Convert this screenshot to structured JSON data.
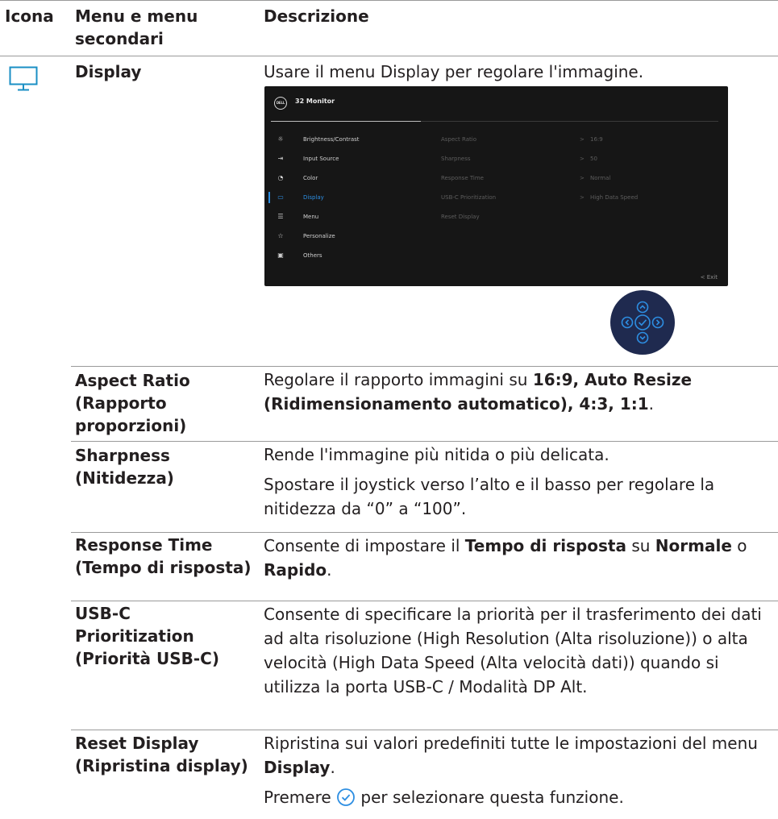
{
  "header": {
    "col_icon": "Icona",
    "col_menu": "Menu e menu secondari",
    "col_desc": "Descrizione"
  },
  "display_row": {
    "icon": "monitor-icon",
    "name": "Display",
    "description": "Usare il menu Display per regolare l'immagine."
  },
  "osd": {
    "logo": "DELL",
    "title": "32 Monitor",
    "menu": [
      {
        "label": "Brightness/Contrast",
        "icon": "sun-icon"
      },
      {
        "label": "Input Source",
        "icon": "input-icon"
      },
      {
        "label": "Color",
        "icon": "palette-icon"
      },
      {
        "label": "Display",
        "icon": "monitor-icon",
        "active": true
      },
      {
        "label": "Menu",
        "icon": "menu-icon"
      },
      {
        "label": "Personalize",
        "icon": "star-icon"
      },
      {
        "label": "Others",
        "icon": "others-icon"
      }
    ],
    "submenu": [
      {
        "label": "Aspect Ratio",
        "value": "16:9"
      },
      {
        "label": "Sharpness",
        "value": "50"
      },
      {
        "label": "Response Time",
        "value": "Normal"
      },
      {
        "label": "USB-C Prioritization",
        "value": "High Data Speed"
      },
      {
        "label": "Reset Display",
        "value": ""
      }
    ],
    "arrow": ">",
    "exit": "< Exit",
    "accent_color": "#2d8ee2"
  },
  "joystick": {
    "icon": "joystick-icon",
    "color": "#1f2a4f"
  },
  "rows": {
    "aspect": {
      "name": "Aspect Ratio (Rapporto proporzioni)",
      "desc_pre": "Regolare il rapporto immagini su ",
      "desc_bold": "16:9, Auto Resize (Ridimensionamento automatico), 4:3, 1:1",
      "desc_post": "."
    },
    "sharpness": {
      "name": "Sharpness (Nitidezza)",
      "desc1": "Rende l'immagine più nitida o più delicata.",
      "desc2": "Spostare il joystick verso l’alto e il basso per regolare la nitidezza da “0” a “100”."
    },
    "response": {
      "name": "Response Time (Tempo di risposta)",
      "desc_a": "Consente di impostare il ",
      "desc_b": "Tempo di risposta",
      "desc_c": " su ",
      "desc_d": "Normale",
      "desc_e": " o ",
      "desc_f": "Rapido",
      "desc_g": "."
    },
    "usbc": {
      "name": "USB-C Prioritization (Priorità USB-C)",
      "desc": "Consente di specificare la priorità per il trasferimento dei dati ad alta risoluzione (High Resolution (Alta risoluzione)) o alta velocità (High Data Speed (Alta velocità dati)) quando si utilizza la porta USB-C / Modalità DP Alt."
    },
    "reset": {
      "name": "Reset Display (Ripristina display)",
      "desc_a": "Ripristina sui valori predefiniti tutte le impostazioni del menu ",
      "desc_b": "Display",
      "desc_c": ".",
      "desc2_pre": "Premere ",
      "desc2_icon": "check-circle-icon",
      "desc2_post": " per selezionare questa funzione."
    }
  }
}
